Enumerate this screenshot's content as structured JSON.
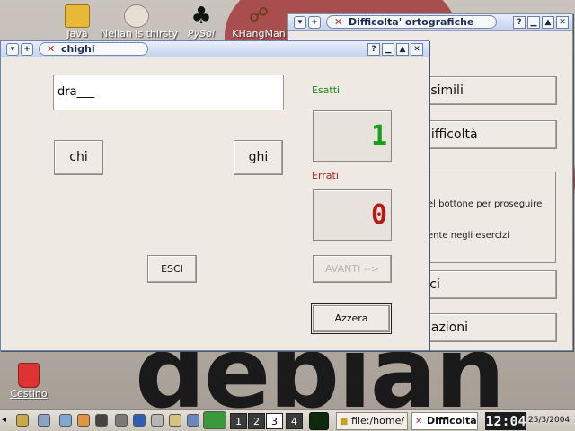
{
  "desktop": {
    "wallpaper_word": "debian",
    "icons": [
      {
        "label": "Java",
        "icon": "folder-icon"
      },
      {
        "label": "Nellan is thirsty",
        "icon": "cat-icon"
      },
      {
        "label": "PySol",
        "icon": "club-card-icon"
      },
      {
        "label": "KHangMan",
        "icon": "hangman-icon"
      }
    ],
    "trash_label": "Cestino"
  },
  "bg_window": {
    "title": "Difficolta' ortografiche",
    "buttons": {
      "simili": "i simili",
      "difficolta": "difficoltà",
      "esci": "sci",
      "informazioni": "nazioni"
    },
    "panel_line1": "el bottone per proseguire",
    "panel_line2": "ente negli esercizi"
  },
  "fg_window": {
    "title": "chighi",
    "word": "dra___",
    "choice_left": "chi",
    "choice_right": "ghi",
    "esatti_label": "Esatti",
    "esatti_value": "1",
    "errati_label": "Errati",
    "errati_value": "0",
    "esci_label": "ESCI",
    "avanti_label": "AVANTI -->",
    "azzera_label": "Azzera"
  },
  "taskbar": {
    "pager": [
      "1",
      "2",
      "3",
      "4"
    ],
    "active_desktop": "3",
    "tasks": [
      "file:/home/",
      "Difficolta"
    ],
    "clock": "12:04",
    "date": "25/3/2004"
  },
  "colors": {
    "accent_green": "#1a8a1a",
    "accent_red": "#b02020",
    "title_blue": "#1d2e56"
  }
}
